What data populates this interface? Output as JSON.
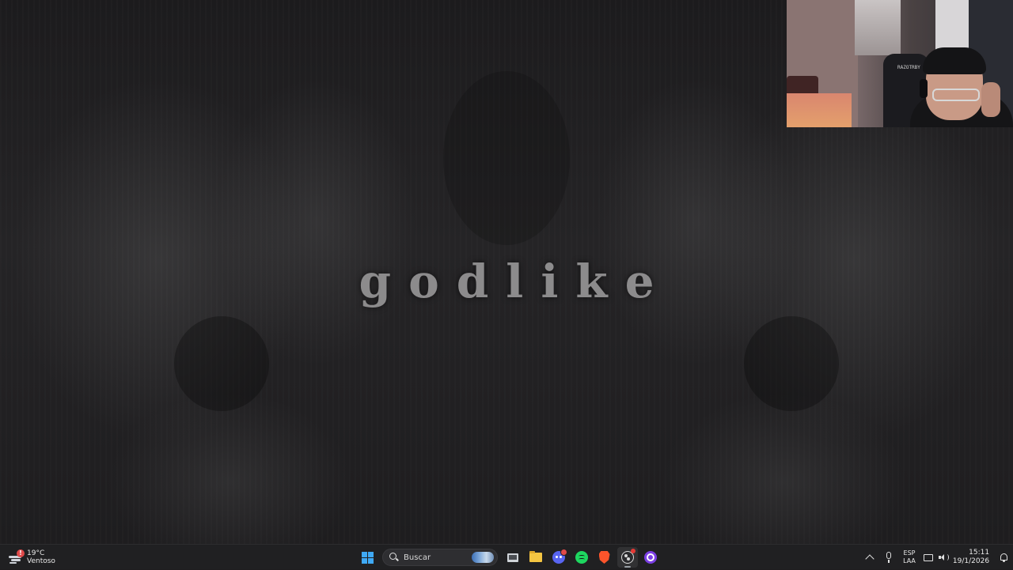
{
  "wallpaper": {
    "title": "godlike"
  },
  "webcam": {
    "chair_label": "RAZOTRBY"
  },
  "taskbar": {
    "weather": {
      "temperature": "19°C",
      "condition": "Ventoso",
      "badge": "!"
    },
    "search": {
      "placeholder": "Buscar"
    },
    "apps": [
      {
        "name": "start",
        "icon": "windows-logo-icon"
      },
      {
        "name": "task-view",
        "icon": "tv-icon"
      },
      {
        "name": "file-explorer",
        "icon": "folder-icon"
      },
      {
        "name": "discord",
        "icon": "discord-icon",
        "notification": true
      },
      {
        "name": "spotify",
        "icon": "spotify-icon"
      },
      {
        "name": "brave",
        "icon": "brave-icon"
      },
      {
        "name": "obs",
        "icon": "obs-icon",
        "recording": true,
        "active": true
      },
      {
        "name": "app-ring",
        "icon": "ring-icon"
      }
    ],
    "tray": {
      "language": "ESP",
      "layout": "LAA",
      "time": "15:11",
      "date": "19/1/2026"
    }
  },
  "colors": {
    "taskbar_bg": "#202022",
    "windows_blue": "#3fa9f5",
    "discord": "#5865f2",
    "spotify": "#1ed760",
    "brave": "#fb542b",
    "ring_app": "#7b3fe4"
  }
}
